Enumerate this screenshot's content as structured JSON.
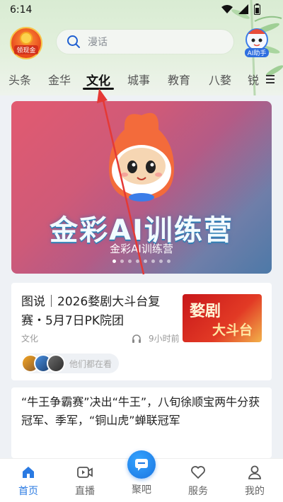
{
  "status_bar": {
    "time": "6:14"
  },
  "header": {
    "coin_label": "领现金",
    "search_placeholder": "漫话",
    "ai_label": "AI助手"
  },
  "tabs": [
    "头条",
    "金华",
    "文化",
    "城事",
    "教育",
    "八婺",
    "锐"
  ],
  "active_tab": "文化",
  "banner": {
    "title": "金彩AI训练营",
    "subtitle": "金彩AI训练营",
    "dot_count": 8,
    "active_dot": 0
  },
  "card1": {
    "title": "图说｜2026婺剧大斗台复赛・5月7日PK院团",
    "thumb_line1": "婺剧",
    "thumb_line2": "大斗台",
    "category": "文化",
    "time": "9小时前",
    "watching_text": "他们都在看"
  },
  "card2": {
    "title": "“牛王争霸赛”决出“牛王”，八旬徐顺宝两牛分获冠军、季军，“铜山虎”蝉联冠军"
  },
  "bottom_nav": {
    "home": "首页",
    "live": "直播",
    "center": "聚吧",
    "service": "服务",
    "mine": "我的"
  },
  "colors": {
    "accent": "#2a7ae2",
    "annotation_arrow": "#e53935"
  }
}
